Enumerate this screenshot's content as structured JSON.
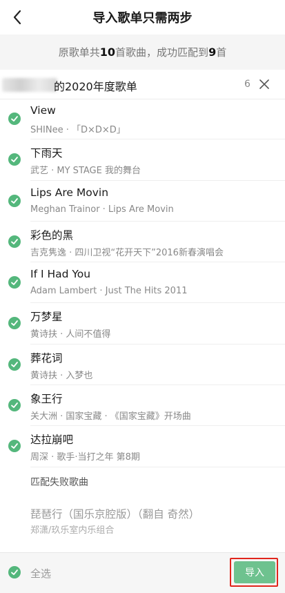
{
  "header": {
    "title": "导入歌单只需两步"
  },
  "summary": {
    "prefix": "原歌单共",
    "total": "10",
    "mid": "首歌曲，成功匹配到",
    "matched": "9",
    "suffix": "首"
  },
  "playlist": {
    "name": "的2020年度歌单",
    "count": "6"
  },
  "songs": [
    {
      "title": "View",
      "subtitle": "SHINee · 「D×D×D」"
    },
    {
      "title": "下雨天",
      "subtitle": "武艺 · MY STAGE 我的舞台"
    },
    {
      "title": "Lips Are Movin",
      "subtitle": "Meghan Trainor · Lips Are Movin"
    },
    {
      "title": "彩色的黑",
      "subtitle": "吉克隽逸 · 四川卫视“花开天下”2016新春演唱会"
    },
    {
      "title": "If I Had You",
      "subtitle": "Adam Lambert · Just The Hits 2011"
    },
    {
      "title": "万梦星",
      "subtitle": "黄诗扶 · 人间不值得"
    },
    {
      "title": "葬花词",
      "subtitle": "黄诗扶 · 入梦也"
    },
    {
      "title": "象王行",
      "subtitle": "关大洲 · 国家宝藏 · 《国家宝藏》开场曲"
    },
    {
      "title": "达拉崩吧",
      "subtitle": "周深 · 歌手·当打之年 第8期"
    }
  ],
  "failed": {
    "header": "匹配失败歌曲",
    "title": "琵琶行（国乐京腔版）（翻自 奇然）",
    "subtitle": "郑潇/玖乐室内乐组合"
  },
  "bottom": {
    "select_all": "全选",
    "import": "导入"
  },
  "colors": {
    "check": "#54b77c",
    "import_button": "#6ec28f",
    "highlight_border": "#e0251b"
  },
  "icons": {
    "back": "chevron-left-icon",
    "close": "close-icon",
    "check": "check-circle-icon"
  }
}
